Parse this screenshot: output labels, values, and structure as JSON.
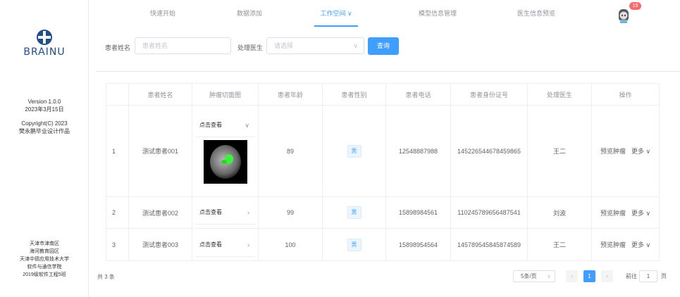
{
  "nav": {
    "items": [
      "快速开始",
      "数据添加",
      "工作空间",
      "模型信息管理",
      "医生信息预览"
    ],
    "active_arrow": "∨",
    "badge": "15"
  },
  "sidebar": {
    "logo_text": "BRAINU",
    "version": "Version 1.0.0",
    "date": "2023年3月15日",
    "copyright": "Copyright(C) 2023",
    "author": "樊永鹏毕业设计作品",
    "footer": [
      "天津市津南区",
      "海河教育园区",
      "天津中德应用技术大学",
      "软件与通信学院",
      "2019级软件工程5班"
    ]
  },
  "search": {
    "name_label": "患者姓名",
    "name_placeholder": "患者姓名",
    "doctor_label": "处理医生",
    "doctor_placeholder": "请选择",
    "query_label": "查询"
  },
  "table": {
    "headers": [
      "",
      "患者姓名",
      "肿瘤切面图",
      "患者年龄",
      "患者性别",
      "患者电话",
      "患者身份证号",
      "处理医生",
      "操作"
    ],
    "rows": [
      {
        "index": "1",
        "name": "测试患者001",
        "view": "点击查看",
        "age": "89",
        "sex": "男",
        "phone": "12548887988",
        "id_card": "145226544678459865",
        "doctor": "王二"
      },
      {
        "index": "2",
        "name": "测试患者002",
        "view": "点击查看",
        "age": "99",
        "sex": "男",
        "phone": "15898984561",
        "id_card": "110245789656487541",
        "doctor": "刘波"
      },
      {
        "index": "3",
        "name": "测试患者003",
        "view": "点击查看",
        "age": "100",
        "sex": "男",
        "phone": "15898954564",
        "id_card": "145789545845874589",
        "doctor": "王二"
      }
    ],
    "op_preview": "预览肿瘤",
    "op_more": "更多 ∨"
  },
  "pagination": {
    "total": "共 3 条",
    "page_size": "5条/页",
    "current": "1",
    "goto_label": "前往",
    "goto_value": "1",
    "page_unit": "页"
  },
  "colors": {
    "primary": "#409eff",
    "badge": "#f56c6c",
    "logo": "#1f4e8c"
  }
}
